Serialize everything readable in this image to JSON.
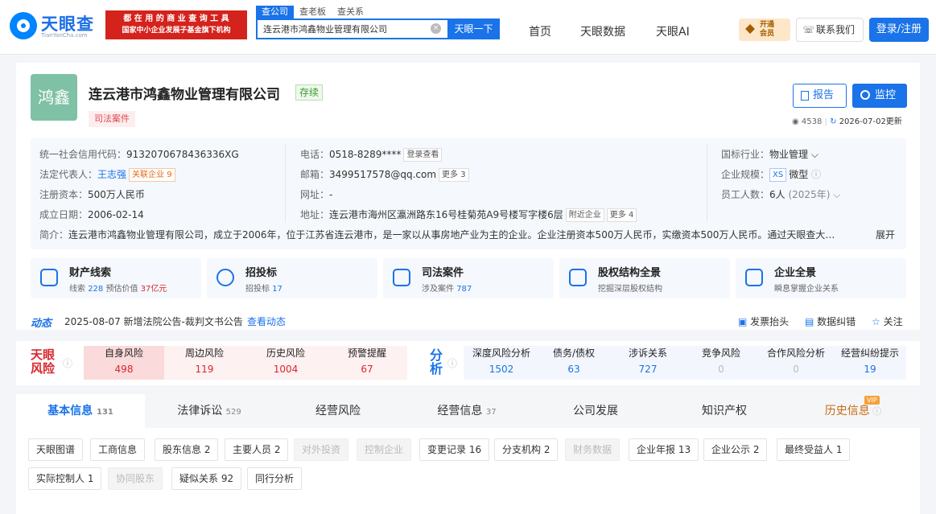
{
  "header": {
    "logo_name": "天眼查",
    "logo_site": "TianYanCha.com",
    "slogan_line1": "都 在 用 的 商 业 查 询 工 具",
    "slogan_line2": "国家中小企业发展子基金旗下机构",
    "search_tabs": [
      "查公司",
      "查老板",
      "查关系"
    ],
    "search_value": "连云港市鸿鑫物业管理有限公司",
    "search_clear": "×",
    "search_button": "天眼一下",
    "nav": [
      "首页",
      "天眼数据",
      "天眼AI"
    ],
    "vip_line1": "开通",
    "vip_line2": "会员",
    "contact": "联系我们",
    "login": "登录/注册"
  },
  "company": {
    "logo_text": "鸿鑫",
    "name": "连云港市鸿鑫物业管理有限公司",
    "status": "存续",
    "tag": "司法案件",
    "report_button": "报告",
    "monitor_button": "监控",
    "views": "4538",
    "updated": "2026-07-02更新"
  },
  "info": {
    "credit_code_label": "统一社会信用代码：",
    "credit_code": "913207067843633​6XG",
    "legal_rep_label": "法定代表人：",
    "legal_rep": "王志强",
    "related": "关联企业 9",
    "capital_label": "注册资本：",
    "capital": "500万人民币",
    "founded_label": "成立日期：",
    "founded": "2006-02-14",
    "phone_label": "电话：",
    "phone": "0518-8289****",
    "phone_btn": "登录查看",
    "email_label": "邮箱：",
    "email": "3499517578@qq.com",
    "email_more": "更多 3",
    "website_label": "网址：",
    "website": "-",
    "address_label": "地址：",
    "address": "连云港市海州区瀛洲路东16号桂菊苑A9号楼写字楼6层",
    "nearby": "附近企业",
    "address_more": "更多 4",
    "industry_label": "国标行业：",
    "industry": "物业管理 ⌵",
    "scale_label": "企业规模：",
    "scale_badge": "XS",
    "scale": "微型",
    "staff_label": "员工人数：",
    "staff": "6人",
    "staff_year": "(2025年) ⌵",
    "intro_label": "简介：",
    "intro": "连云港市鸿鑫物业管理有限公司，成立于2006年，位于江苏省连云港市，是一家以从事房地产业为主的企业。企业注册资本500万人民币，实缴资本500万人民币。通过天眼查大…",
    "expand": "展开"
  },
  "features": [
    {
      "title": "财产线索",
      "sub_a": "线索 ",
      "num_a": "228",
      "sub_b": "  预估价值 ",
      "num_b": "37亿元"
    },
    {
      "title": "招投标",
      "sub_a": "招投标 ",
      "num_a": "17",
      "sub_b": "",
      "num_b": ""
    },
    {
      "title": "司法案件",
      "sub_a": "涉及案件 ",
      "num_a": "787",
      "sub_b": "",
      "num_b": ""
    },
    {
      "title": "股权结构全景",
      "sub_a": "挖掘深层股权结构",
      "num_a": "",
      "sub_b": "",
      "num_b": ""
    },
    {
      "title": "企业全景",
      "sub_a": "瞬息掌握企业关系",
      "num_a": "",
      "sub_b": "",
      "num_b": ""
    }
  ],
  "dynamic": {
    "label": "动态",
    "text": "2025-08-07 新增法院公告-裁判文书公告",
    "link": "查看动态",
    "invoice": "发票抬头",
    "correct": "数据纠错",
    "follow": "关注"
  },
  "risk": {
    "logo_a": "天眼",
    "logo_b": "风险",
    "items": [
      {
        "label": "自身风险",
        "value": "498"
      },
      {
        "label": "周边风险",
        "value": "119"
      },
      {
        "label": "历史风险",
        "value": "1004"
      },
      {
        "label": "预警提醒",
        "value": "67"
      }
    ],
    "analysis_a": "分",
    "analysis_b": "析",
    "analysis": [
      {
        "label": "深度风险分析",
        "value": "1502"
      },
      {
        "label": "债务/债权",
        "value": "63"
      },
      {
        "label": "涉诉关系",
        "value": "727"
      },
      {
        "label": "竞争风险",
        "value": "0"
      },
      {
        "label": "合作风险分析",
        "value": "0"
      },
      {
        "label": "经营纠纷提示",
        "value": "19"
      }
    ]
  },
  "tabs": [
    {
      "label": "基本信息",
      "count": "131"
    },
    {
      "label": "法律诉讼",
      "count": "529"
    },
    {
      "label": "经营风险",
      "count": ""
    },
    {
      "label": "经营信息",
      "count": "37"
    },
    {
      "label": "公司发展",
      "count": ""
    },
    {
      "label": "知识产权",
      "count": ""
    },
    {
      "label": "历史信息",
      "count": ""
    }
  ],
  "history_vip": "VIP",
  "chips": [
    "天眼图谱",
    "工商信息",
    "股东信息 2",
    "主要人员 2",
    "对外投资",
    "控制企业",
    "变更记录 16",
    "分支机构 2",
    "财务数据",
    "企业年报 13",
    "企业公示 2",
    "最终受益人 1",
    "实际控制人 1",
    "协同股东",
    "疑似关系 92",
    "同行分析"
  ],
  "colors": {
    "accent": "#1a73e8",
    "risk": "#d9272e",
    "status_green": "#3a9b2f"
  }
}
